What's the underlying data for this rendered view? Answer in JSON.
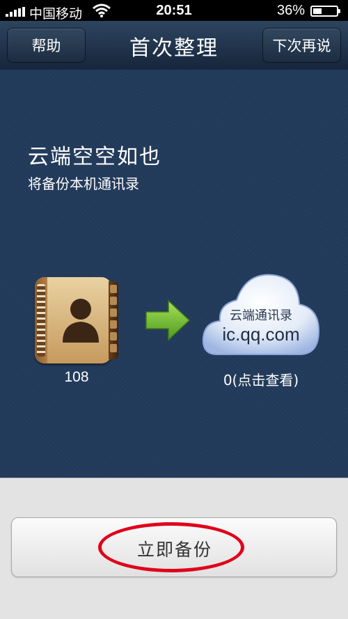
{
  "status_bar": {
    "carrier": "中国移动",
    "time": "20:51",
    "battery_percent": "36%",
    "battery_level": 0.36
  },
  "nav": {
    "help_label": "帮助",
    "title": "首次整理",
    "later_label": "下次再说"
  },
  "main": {
    "heading": "云端空空如也",
    "subheading": "将备份本机通讯录",
    "local_contacts_count": "108",
    "cloud_title": "云端通讯录",
    "cloud_url": "ic.qq.com",
    "cloud_status": "0(点击查看)"
  },
  "action": {
    "backup_label": "立即备份"
  },
  "colors": {
    "highlight_ring": "#e0001a",
    "arrow_green": "#6bc12b",
    "main_bg": "#213959"
  }
}
